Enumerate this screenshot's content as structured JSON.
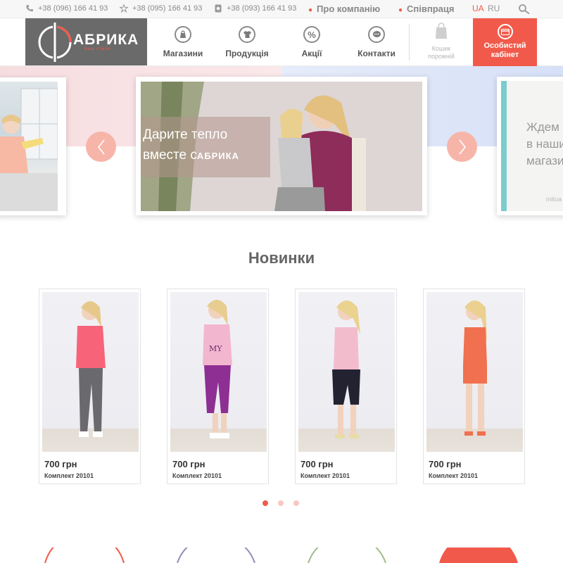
{
  "topbar": {
    "phone1": "+38 (096) 166 41 93",
    "phone2": "+38 (095) 166 41 93",
    "phone3": "+38 (093) 166 41 93",
    "about_label": "Про компанію",
    "partner_label": "Співпраця",
    "lang_ua": "UA",
    "lang_ru": "RU",
    "icons": [
      "phone-icon",
      "kyivstar-icon",
      "life-icon",
      "search-icon"
    ]
  },
  "header": {
    "logo_text": "АБРИКА",
    "logo_sub": "ваш стиль",
    "nav": [
      {
        "label": "Магазини",
        "icon": "bag-icon"
      },
      {
        "label": "Продукція",
        "icon": "shirt-icon"
      },
      {
        "label": "Акції",
        "icon": "percent-icon"
      },
      {
        "label": "Контакти",
        "icon": "chat-icon"
      }
    ],
    "cart_line1": "Кошик",
    "cart_line2": "порожній",
    "cabinet_line1": "Особистий",
    "cabinet_line2": "кабінет"
  },
  "slider": {
    "promo_line1": "Дарите тепло",
    "promo_line2": "вместе с",
    "promo_brand": "АБРИКА",
    "right_text_1": "Ждем В",
    "right_text_2": "в наши",
    "right_text_3": "магазин",
    "right_small": "mitua"
  },
  "section": {
    "title": "Новинки"
  },
  "products": [
    {
      "price": "700 грн",
      "name": "Комплект 20101",
      "top_color": "#f7647a",
      "bottom_color": "#6a6a6e"
    },
    {
      "price": "700 грн",
      "name": "Комплект 20101",
      "top_color": "#f3b6cf",
      "bottom_color": "#8e2f93"
    },
    {
      "price": "700 грн",
      "name": "Комплект 20101",
      "top_color": "#f3bccd",
      "bottom_color": "#222230"
    },
    {
      "price": "700 грн",
      "name": "Комплект 20101",
      "top_color": "#f0704f",
      "bottom_color": "#f0704f"
    }
  ],
  "pagination": {
    "count": 3,
    "active": 1
  },
  "colors": {
    "accent": "#f15a4a",
    "logo_bg": "#6a6a6a",
    "arrow": "#f7b5aa"
  }
}
